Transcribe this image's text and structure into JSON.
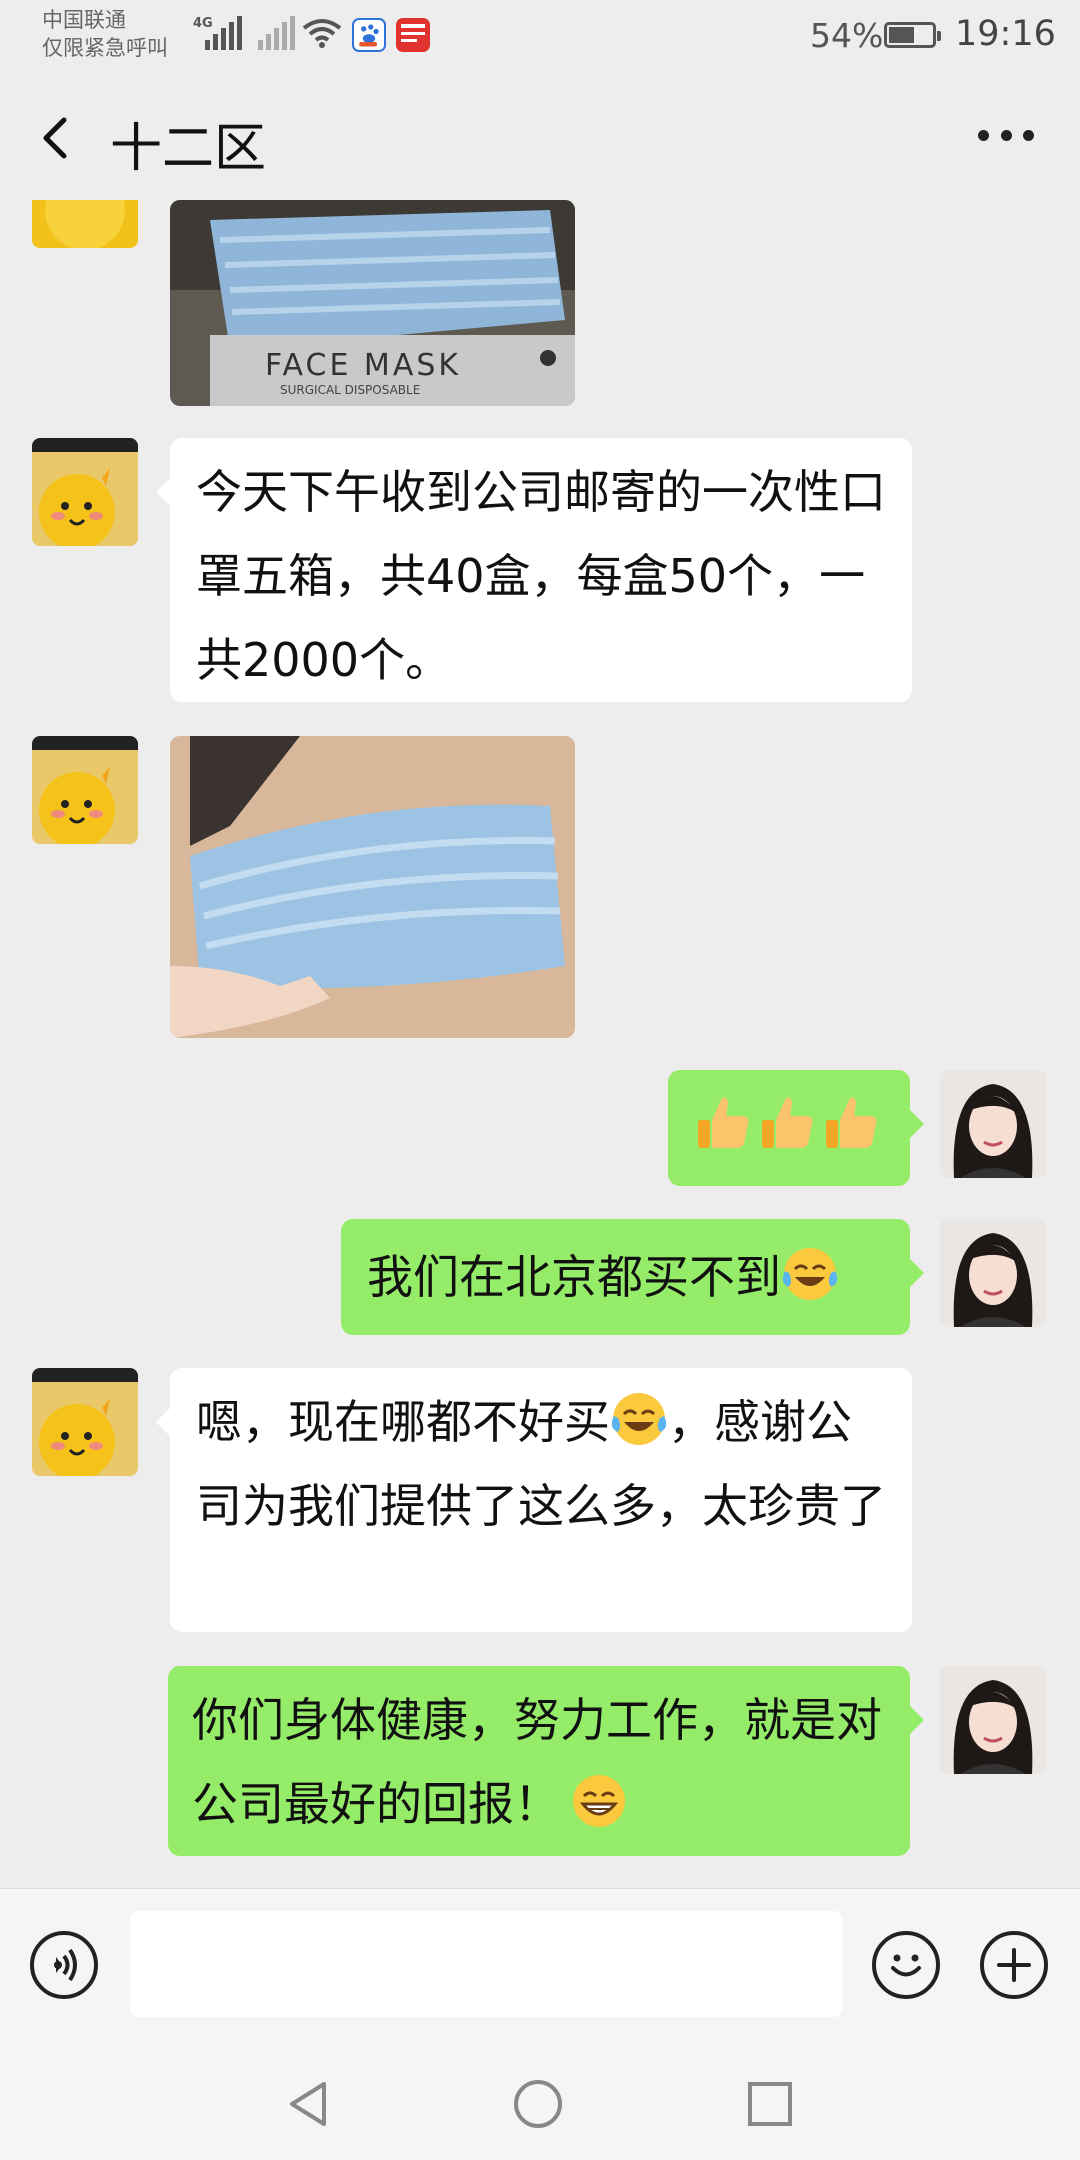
{
  "status_bar": {
    "carrier_line1": "中国联通",
    "carrier_line2": "仅限紧急呼叫",
    "network": "4G",
    "battery": "54%",
    "battery_level": 0.54,
    "time": "19:16"
  },
  "header": {
    "back_icon": "chevron-left-icon",
    "title": "十二区",
    "more_icon": "more-icon"
  },
  "messages": [
    {
      "type": "image",
      "side": "in",
      "description_icon": "mask-box-photo"
    },
    {
      "type": "text",
      "side": "in",
      "text": "今天下午收到公司邮寄的一次性口罩五箱，共40盒，每盒50个，一共2000个。"
    },
    {
      "type": "image",
      "side": "in",
      "description_icon": "mask-photo"
    },
    {
      "type": "emoji",
      "side": "out",
      "emoji": [
        "thumbs-up-icon",
        "thumbs-up-icon",
        "thumbs-up-icon"
      ]
    },
    {
      "type": "text",
      "side": "out",
      "text": "我们在北京都买不到",
      "emoji": "crying-laughing-emoji"
    },
    {
      "type": "text",
      "side": "in",
      "text_before": "嗯，现在哪都不好买",
      "emoji": "crying-laughing-emoji",
      "text_after": "，感谢公司为我们提供了这么多，太珍贵了"
    },
    {
      "type": "text",
      "side": "out",
      "text": "你们身体健康，努力工作，就是对公司最好的回报！",
      "emoji": "grinning-emoji"
    }
  ],
  "input_bar": {
    "voice_icon": "voice-icon",
    "text_value": "",
    "emoji_icon": "smiley-icon",
    "plus_icon": "plus-icon"
  },
  "nav_bar": {
    "back_icon": "triangle-back-icon",
    "home_icon": "circle-home-icon",
    "recents_icon": "square-recents-icon"
  }
}
